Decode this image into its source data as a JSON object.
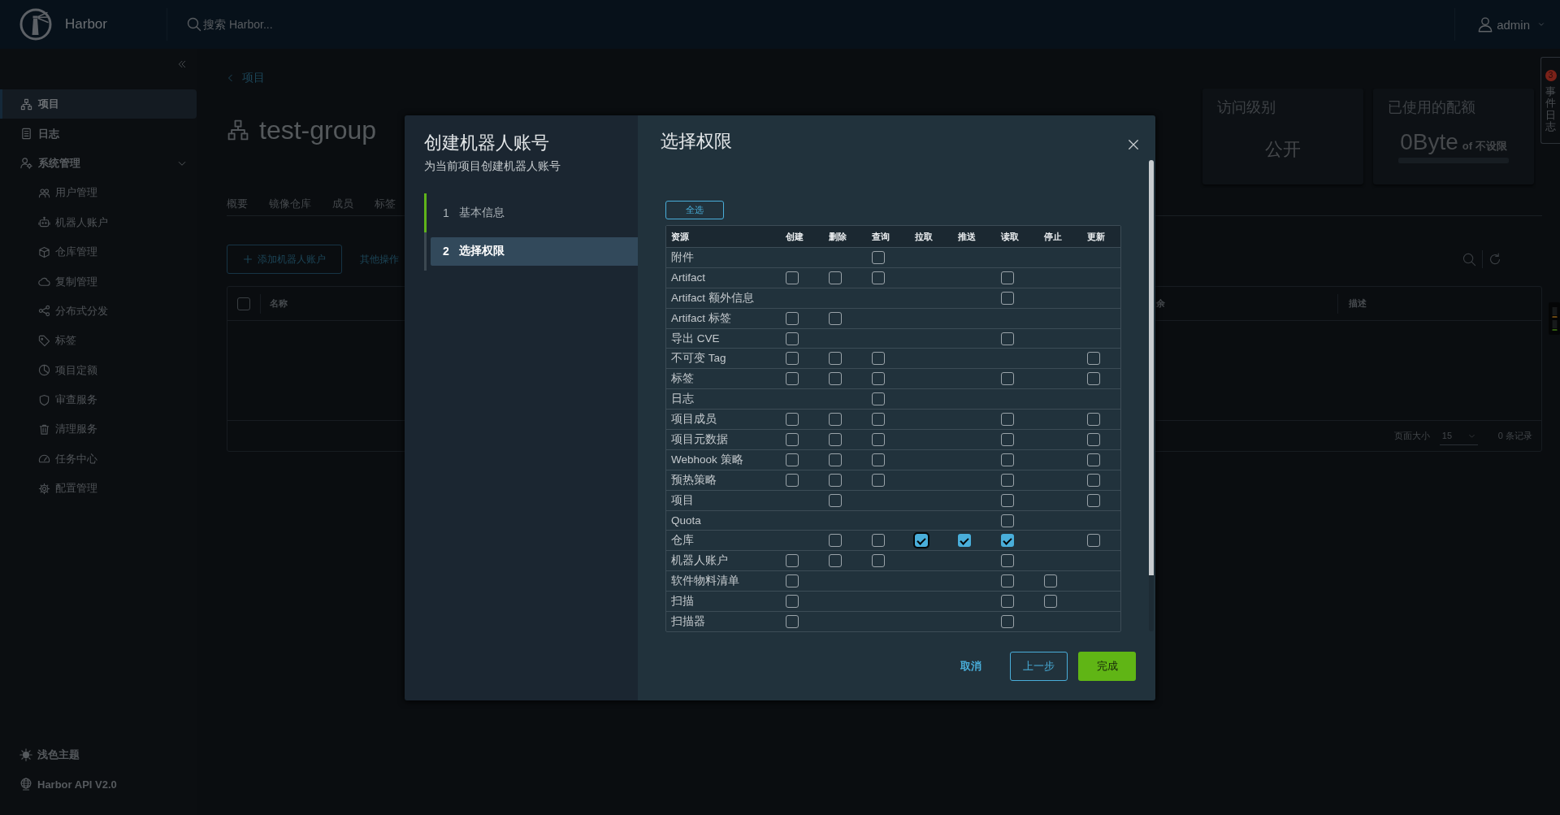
{
  "header": {
    "brand": "Harbor",
    "search": {
      "placeholder": "搜索 Harbor..."
    },
    "user": "admin"
  },
  "sidebar": {
    "items": [
      {
        "label": "项目",
        "selected": true
      },
      {
        "label": "日志",
        "selected": false
      },
      {
        "label": "系统管理",
        "selected": false,
        "expanded": true,
        "children": [
          {
            "label": "用户管理",
            "selected": false
          },
          {
            "label": "机器人账户",
            "selected": false
          },
          {
            "label": "仓库管理",
            "selected": false
          },
          {
            "label": "复制管理",
            "selected": false
          },
          {
            "label": "分布式分发",
            "selected": false
          },
          {
            "label": "标签",
            "selected": false
          },
          {
            "label": "项目定额",
            "selected": false
          },
          {
            "label": "审查服务",
            "selected": false
          },
          {
            "label": "清理服务",
            "selected": false
          },
          {
            "label": "任务中心",
            "selected": false
          },
          {
            "label": "配置管理",
            "selected": false
          }
        ]
      }
    ],
    "footer": [
      {
        "label": "浅色主题"
      },
      {
        "label": "Harbor API V2.0"
      }
    ]
  },
  "page": {
    "breadcrumb": "项目",
    "title": "test-group",
    "cards": [
      {
        "title": "访问级别",
        "value": "公开"
      },
      {
        "title": "已使用的配额",
        "value": "0Byte",
        "note": "of 不设限",
        "level": 0
      }
    ],
    "tabs": [
      {
        "label": "概要",
        "selected": false
      },
      {
        "label": "镜像仓库",
        "selected": false
      },
      {
        "label": "成员",
        "selected": false
      },
      {
        "label": "标签",
        "selected": false
      }
    ],
    "toolbar": {
      "add_button": "添加机器人账户",
      "more": "其他操作"
    },
    "table": {
      "select_all": {
        "checked": false
      },
      "columns": [
        "名称",
        "余",
        "描述"
      ],
      "page_size_label": "页面大小",
      "page_size": "15",
      "total": "0 条记录"
    }
  },
  "event_log": {
    "label": "事件日志",
    "badge": "3"
  },
  "modal": {
    "title": "创建机器人账号",
    "subtitle": "为当前项目创建机器人账号",
    "steps": [
      {
        "number": "1",
        "label": "基本信息",
        "selected": false,
        "completed": true
      },
      {
        "number": "2",
        "label": "选择权限",
        "selected": true,
        "completed": false
      }
    ],
    "panel_title": "选择权限",
    "select_all": "全选",
    "permissions": {
      "columns": [
        "资源",
        "创建",
        "删除",
        "查询",
        "拉取",
        "推送",
        "读取",
        "停止",
        "更新"
      ],
      "rows": [
        {
          "resource": "附件",
          "cells": [
            null,
            null,
            {
              "checked": false,
              "focused": false
            },
            null,
            null,
            null,
            null,
            null
          ]
        },
        {
          "resource": "Artifact",
          "cells": [
            {
              "checked": false,
              "focused": false
            },
            {
              "checked": false,
              "focused": false
            },
            {
              "checked": false,
              "focused": false
            },
            null,
            null,
            {
              "checked": false,
              "focused": false
            },
            null,
            null
          ]
        },
        {
          "resource": "Artifact 额外信息",
          "cells": [
            null,
            null,
            null,
            null,
            null,
            {
              "checked": false,
              "focused": false
            },
            null,
            null
          ]
        },
        {
          "resource": "Artifact 标签",
          "cells": [
            {
              "checked": false,
              "focused": false
            },
            {
              "checked": false,
              "focused": false
            },
            null,
            null,
            null,
            null,
            null,
            null
          ]
        },
        {
          "resource": "导出 CVE",
          "cells": [
            {
              "checked": false,
              "focused": false
            },
            null,
            null,
            null,
            null,
            {
              "checked": false,
              "focused": false
            },
            null,
            null
          ]
        },
        {
          "resource": "不可变 Tag",
          "cells": [
            {
              "checked": false,
              "focused": false
            },
            {
              "checked": false,
              "focused": false
            },
            {
              "checked": false,
              "focused": false
            },
            null,
            null,
            null,
            null,
            {
              "checked": false,
              "focused": false
            }
          ]
        },
        {
          "resource": "标签",
          "cells": [
            {
              "checked": false,
              "focused": false
            },
            {
              "checked": false,
              "focused": false
            },
            {
              "checked": false,
              "focused": false
            },
            null,
            null,
            {
              "checked": false,
              "focused": false
            },
            null,
            {
              "checked": false,
              "focused": false
            }
          ]
        },
        {
          "resource": "日志",
          "cells": [
            null,
            null,
            {
              "checked": false,
              "focused": false
            },
            null,
            null,
            null,
            null,
            null
          ]
        },
        {
          "resource": "项目成员",
          "cells": [
            {
              "checked": false,
              "focused": false
            },
            {
              "checked": false,
              "focused": false
            },
            {
              "checked": false,
              "focused": false
            },
            null,
            null,
            {
              "checked": false,
              "focused": false
            },
            null,
            {
              "checked": false,
              "focused": false
            }
          ]
        },
        {
          "resource": "项目元数据",
          "cells": [
            {
              "checked": false,
              "focused": false
            },
            {
              "checked": false,
              "focused": false
            },
            {
              "checked": false,
              "focused": false
            },
            null,
            null,
            {
              "checked": false,
              "focused": false
            },
            null,
            {
              "checked": false,
              "focused": false
            }
          ]
        },
        {
          "resource": "Webhook 策略",
          "cells": [
            {
              "checked": false,
              "focused": false
            },
            {
              "checked": false,
              "focused": false
            },
            {
              "checked": false,
              "focused": false
            },
            null,
            null,
            {
              "checked": false,
              "focused": false
            },
            null,
            {
              "checked": false,
              "focused": false
            }
          ]
        },
        {
          "resource": "预热策略",
          "cells": [
            {
              "checked": false,
              "focused": false
            },
            {
              "checked": false,
              "focused": false
            },
            {
              "checked": false,
              "focused": false
            },
            null,
            null,
            {
              "checked": false,
              "focused": false
            },
            null,
            {
              "checked": false,
              "focused": false
            }
          ]
        },
        {
          "resource": "项目",
          "cells": [
            null,
            {
              "checked": false,
              "focused": false
            },
            null,
            null,
            null,
            {
              "checked": false,
              "focused": false
            },
            null,
            {
              "checked": false,
              "focused": false
            }
          ]
        },
        {
          "resource": "Quota",
          "cells": [
            null,
            null,
            null,
            null,
            null,
            {
              "checked": false,
              "focused": false
            },
            null,
            null
          ]
        },
        {
          "resource": "仓库",
          "cells": [
            null,
            {
              "checked": false,
              "focused": false
            },
            {
              "checked": false,
              "focused": false
            },
            {
              "checked": true,
              "focused": true
            },
            {
              "checked": true,
              "focused": false
            },
            {
              "checked": true,
              "focused": false
            },
            null,
            {
              "checked": false,
              "focused": false
            }
          ]
        },
        {
          "resource": "机器人账户",
          "cells": [
            {
              "checked": false,
              "focused": false
            },
            {
              "checked": false,
              "focused": false
            },
            {
              "checked": false,
              "focused": false
            },
            null,
            null,
            {
              "checked": false,
              "focused": false
            },
            null,
            null
          ]
        },
        {
          "resource": "软件物料清单",
          "cells": [
            {
              "checked": false,
              "focused": false
            },
            null,
            null,
            null,
            null,
            {
              "checked": false,
              "focused": false
            },
            {
              "checked": false,
              "focused": false
            },
            null
          ]
        },
        {
          "resource": "扫描",
          "cells": [
            {
              "checked": false,
              "focused": false
            },
            null,
            null,
            null,
            null,
            {
              "checked": false,
              "focused": false
            },
            {
              "checked": false,
              "focused": false
            },
            null
          ]
        },
        {
          "resource": "扫描器",
          "cells": [
            {
              "checked": false,
              "focused": false
            },
            null,
            null,
            null,
            null,
            {
              "checked": false,
              "focused": false
            },
            null,
            null
          ]
        }
      ]
    },
    "buttons": [
      {
        "label": "取消",
        "kind": "link"
      },
      {
        "label": "上一步",
        "kind": "outline"
      },
      {
        "label": "完成",
        "kind": "primary"
      }
    ]
  }
}
